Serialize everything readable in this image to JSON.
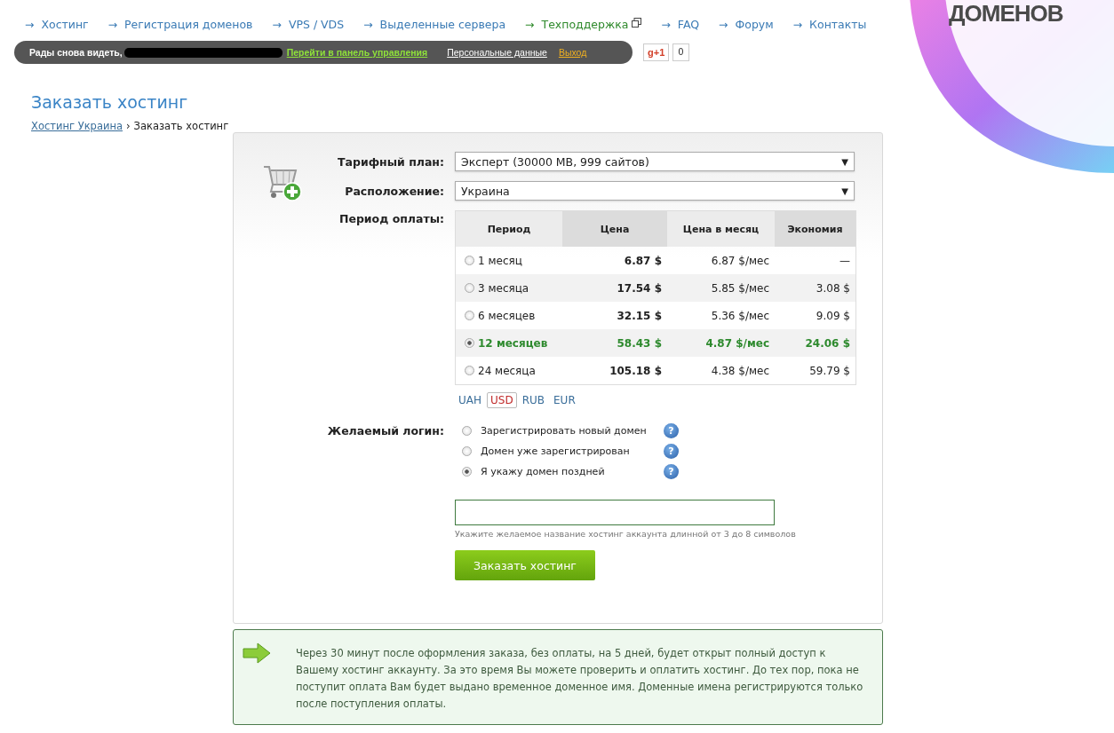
{
  "nav": [
    {
      "arrow": "→",
      "label": "Хостинг",
      "selected": false,
      "external": false
    },
    {
      "arrow": "→",
      "label": "Регистрация доменов",
      "selected": false,
      "external": false
    },
    {
      "arrow": "→",
      "label": "VPS / VDS",
      "selected": false,
      "external": false
    },
    {
      "arrow": "→",
      "label": "Выделенные сервера",
      "selected": false,
      "external": false
    },
    {
      "arrow": "→",
      "label": "Техподдержка",
      "selected": true,
      "external": true
    },
    {
      "arrow": "→",
      "label": "FAQ",
      "selected": false,
      "external": false
    },
    {
      "arrow": "→",
      "label": "Форум",
      "selected": false,
      "external": false
    },
    {
      "arrow": "→",
      "label": "Контакты",
      "selected": false,
      "external": false
    }
  ],
  "logo": {
    "text": "ДОМЕНОВ"
  },
  "session_bar": {
    "greeting": "Рады снова видеть,",
    "panel_link": "Перейти в панель управления",
    "profile_link": "Персональные данные",
    "logout_link": "Выход"
  },
  "gplus": {
    "label": "g+1",
    "count": "0"
  },
  "page_title": "Заказать хостинг",
  "breadcrumb": {
    "link": "Хостинг Украина",
    "separator": "›",
    "current": "Заказать хостинг"
  },
  "form": {
    "plan": {
      "label": "Тарифный план:",
      "value": "Эксперт (30000 MB, 999 сайтов)",
      "caret": "▼"
    },
    "location": {
      "label": "Расположение:",
      "value": "Украина",
      "caret": "▼"
    },
    "period_label": "Период оплаты:",
    "table": {
      "columns": [
        "Период",
        "Цена",
        "Цена в месяц",
        "Экономия"
      ],
      "rows": [
        {
          "period": "1 месяц",
          "price": "6.87 $",
          "monthly": "6.87 $/мес",
          "saving": "—",
          "selected": false
        },
        {
          "period": "3 месяца",
          "price": "17.54 $",
          "monthly": "5.85 $/мес",
          "saving": "3.08 $",
          "selected": false
        },
        {
          "period": "6 месяцев",
          "price": "32.15 $",
          "monthly": "5.36 $/мес",
          "saving": "9.09 $",
          "selected": false
        },
        {
          "period": "12 месяцев",
          "price": "58.43 $",
          "monthly": "4.87 $/мес",
          "saving": "24.06 $",
          "selected": true
        },
        {
          "period": "24 месяца",
          "price": "105.18 $",
          "monthly": "4.38 $/мес",
          "saving": "59.79 $",
          "selected": false
        }
      ]
    },
    "currencies": [
      {
        "label": "UAH",
        "selected": false
      },
      {
        "label": "USD",
        "selected": true
      },
      {
        "label": "RUB",
        "selected": false
      },
      {
        "label": "EUR",
        "selected": false
      }
    ],
    "login_label": "Желаемый логин:",
    "login_options": [
      {
        "label": "Зарегистрировать новый домен",
        "selected": false,
        "help": "?"
      },
      {
        "label": "Домен уже зарегистрирован",
        "selected": false,
        "help": "?"
      },
      {
        "label": "Я укажу домен поздней",
        "selected": true,
        "help": "?"
      }
    ],
    "hint": "Укажите желаемое название хостинг аккаунта длинной от 3 до 8 символов",
    "submit": "Заказать хостинг"
  },
  "notice": "Через 30 минут после оформления заказа, без оплаты, на 5 дней, будет открыт полный доступ к Вашему хостинг аккаунту. За это время Вы можете проверить и оплатить хостинг. До тех пор, пока не поступит оплата Вам будет выдано временное доменное имя. Доменные имена регистрируются только после поступления оплаты."
}
